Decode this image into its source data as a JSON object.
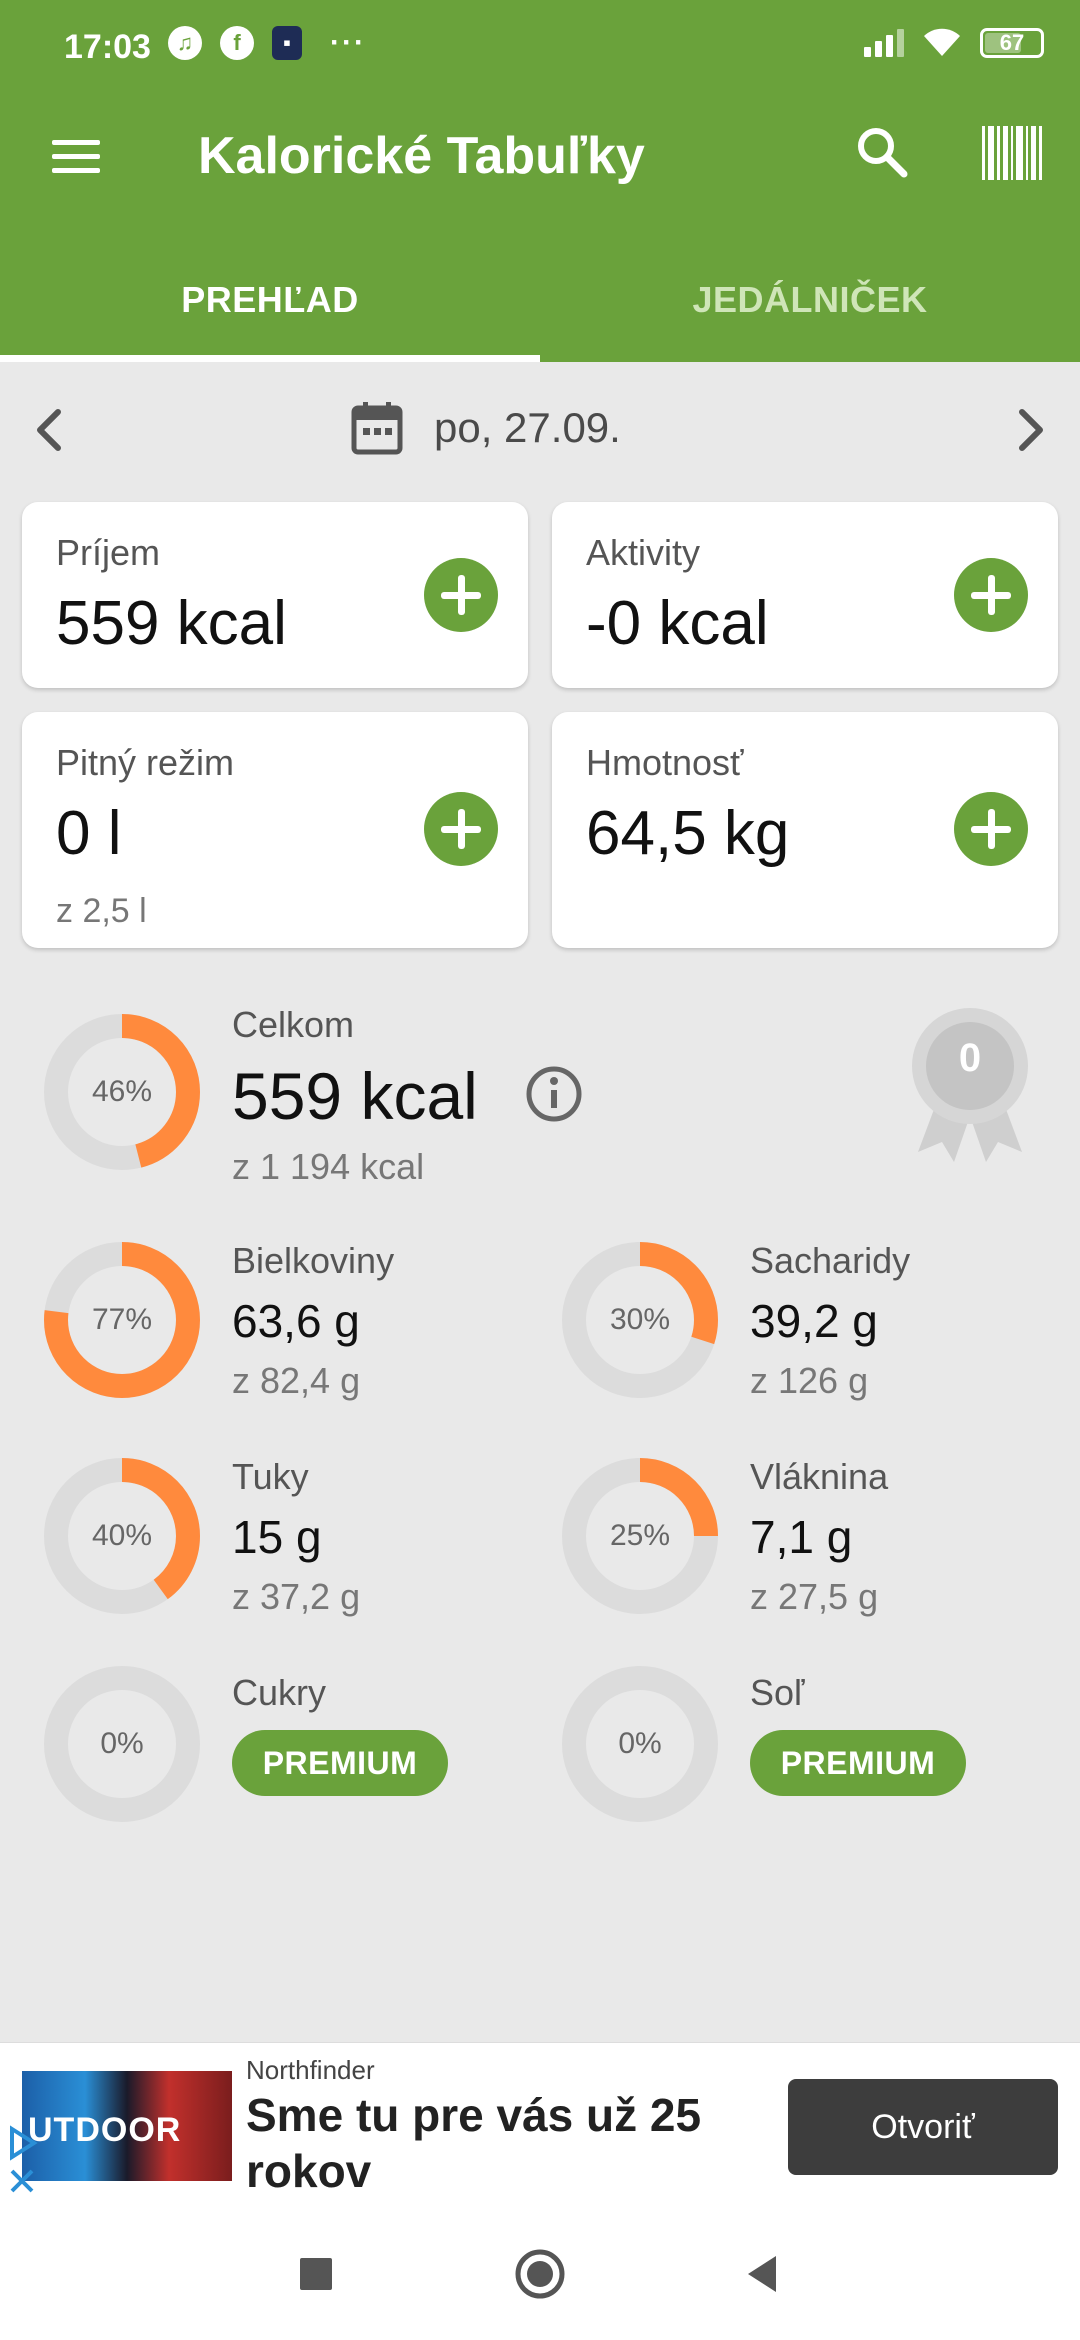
{
  "status_bar": {
    "time": "17:03",
    "battery": "67",
    "more": "···"
  },
  "app": {
    "title": "Kalorické Tabuľky",
    "accent_color": "#6aa23b",
    "ring_color": "#ff8a3d"
  },
  "tabs": [
    {
      "label": "PREHĽAD",
      "active": true
    },
    {
      "label": "JEDÁLNIČEK",
      "active": false
    }
  ],
  "date_nav": {
    "date": "po, 27.09."
  },
  "cards": {
    "intake": {
      "label": "Príjem",
      "value": "559 kcal"
    },
    "activity": {
      "label": "Aktivity",
      "value": "-0 kcal"
    },
    "water": {
      "label": "Pitný režim",
      "value": "0 l",
      "sub": "z 2,5 l"
    },
    "weight": {
      "label": "Hmotnosť",
      "value": "64,5 kg"
    }
  },
  "summary": {
    "total": {
      "label": "Celkom",
      "value": "559 kcal",
      "sub": "z 1 194 kcal",
      "percent_label": "46%",
      "fraction": 0.46
    },
    "badge_count": "0"
  },
  "nutrients": [
    {
      "label": "Bielkoviny",
      "value": "63,6 g",
      "sub": "z 82,4 g",
      "percent_label": "77%",
      "fraction": 0.77
    },
    {
      "label": "Sacharidy",
      "value": "39,2 g",
      "sub": "z 126 g",
      "percent_label": "30%",
      "fraction": 0.3
    },
    {
      "label": "Tuky",
      "value": "15 g",
      "sub": "z 37,2 g",
      "percent_label": "40%",
      "fraction": 0.4
    },
    {
      "label": "Vláknina",
      "value": "7,1 g",
      "sub": "z 27,5 g",
      "percent_label": "25%",
      "fraction": 0.25
    },
    {
      "label": "Cukry",
      "premium": "PREMIUM",
      "percent_label": "0%",
      "fraction": 0
    },
    {
      "label": "Soľ",
      "premium": "PREMIUM",
      "percent_label": "0%",
      "fraction": 0
    }
  ],
  "ad": {
    "image_text": "UTDOOR",
    "brand": "Northfinder",
    "headline": "Sme tu pre vás už 25 rokov",
    "cta": "Otvoriť"
  }
}
